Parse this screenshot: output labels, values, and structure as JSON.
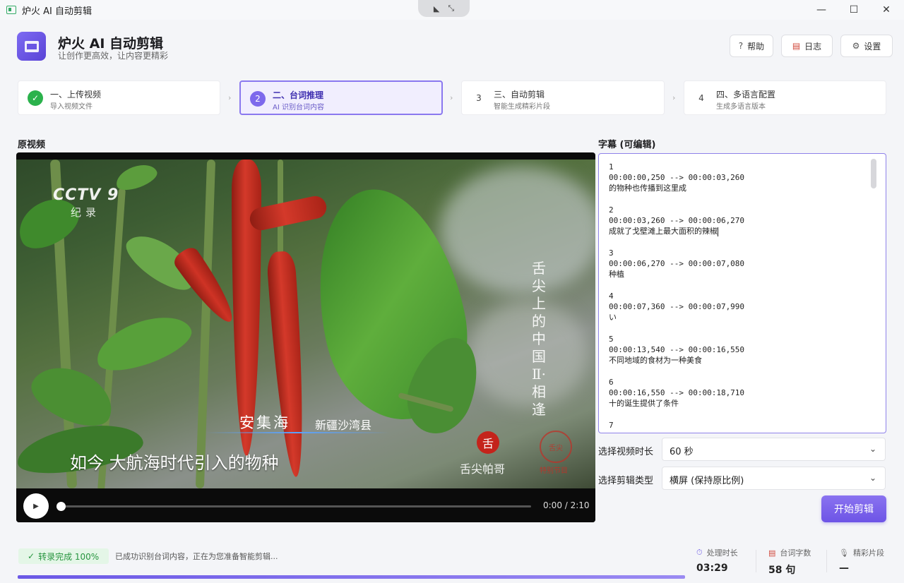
{
  "window": {
    "title": "炉火 AI 自动剪辑",
    "minimize": "—",
    "maximize": "☐",
    "close": "✕"
  },
  "header": {
    "title": "炉火 AI 自动剪辑",
    "subtitle": "让创作更高效，让内容更精彩",
    "help": "帮助",
    "log": "日志",
    "settings": "设置",
    "help_icon": "?",
    "log_icon": "▤",
    "settings_icon": "⚙"
  },
  "steps": [
    {
      "badge": "✓",
      "title": "一、上传视频",
      "sub": "导入视频文件",
      "state": "done"
    },
    {
      "badge": "2",
      "title": "二、台词推理",
      "sub": "AI 识别台词内容",
      "state": "active"
    },
    {
      "badge": "3",
      "title": "三、自动剪辑",
      "sub": "智能生成精彩片段",
      "state": "pending"
    },
    {
      "badge": "4",
      "title": "四、多语言配置",
      "sub": "生成多语言版本",
      "state": "pending"
    }
  ],
  "video": {
    "label": "原视频",
    "overlay": {
      "channel": "CCTV 9",
      "channel_sub": "纪录",
      "series_title": "舌尖上的中国Ⅱ·相逢",
      "place": "安集海",
      "place_sub": "新疆沙湾县",
      "caption": "如今 大航海时代引入的物种",
      "seal": "舌",
      "seal_text": "舌尖帕哥",
      "seal2": "舌尖",
      "seal2_text": "特别节目"
    },
    "time": "0:00 / 2:10",
    "progress": 0
  },
  "subtitles": {
    "label": "字幕 (可编辑)",
    "cues": [
      {
        "index": "1",
        "time": "00:00:00,250 --> 00:00:03,260",
        "text": "的物种也传播到这里成"
      },
      {
        "index": "2",
        "time": "00:00:03,260 --> 00:00:06,270",
        "text": "成就了戈壁滩上最大面积的辣椒"
      },
      {
        "index": "3",
        "time": "00:00:06,270 --> 00:00:07,080",
        "text": "种植"
      },
      {
        "index": "4",
        "time": "00:00:07,360 --> 00:00:07,990",
        "text": "い"
      },
      {
        "index": "5",
        "time": "00:00:13,540 --> 00:00:16,550",
        "text": "不同地域的食材为一种美食"
      },
      {
        "index": "6",
        "time": "00:00:16,550 --> 00:00:18,710",
        "text": "十的诞生提供了条件"
      },
      {
        "index": "7",
        "time": "",
        "text": ""
      }
    ]
  },
  "options": {
    "duration_label": "选择视频时长",
    "duration_value": "60 秒",
    "type_label": "选择剪辑类型",
    "type_value": "横屏 (保持原比例)",
    "chevron": "⌄",
    "start": "开始剪辑"
  },
  "status": {
    "badge": "转录完成 100%",
    "badge_icon": "✓",
    "message": "已成功识别台词内容，正在为您准备智能剪辑...",
    "progress": 0.75,
    "stats": [
      {
        "label": "处理时长",
        "value": "03:29"
      },
      {
        "label": "台词字数",
        "value": "58 句"
      },
      {
        "label": "精彩片段",
        "value": "—"
      }
    ]
  },
  "colors": {
    "accent": "#7d69ec",
    "success": "#2bb24c"
  }
}
